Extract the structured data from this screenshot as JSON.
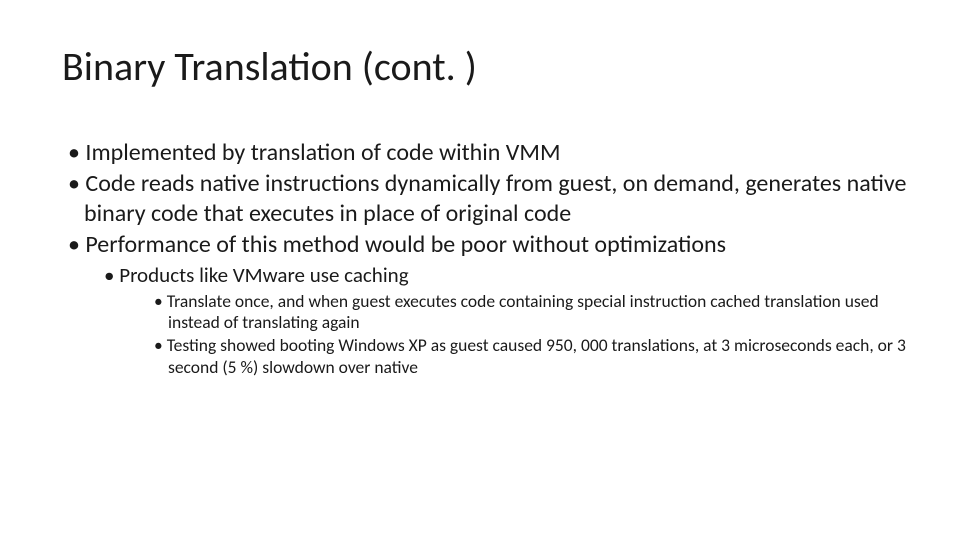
{
  "slide": {
    "title": "Binary Translation (cont. )",
    "bullets": {
      "b1": "Implemented by translation of code within VMM",
      "b2": "Code reads native instructions dynamically from guest, on demand, generates native binary code that executes in place of original code",
      "b3": "Performance of this method would be poor without optimizations",
      "b3_1": "Products like VMware use caching",
      "b3_1_1": "Translate once, and when guest executes code containing special instruction cached translation used instead of translating again",
      "b3_1_2": "Testing showed booting Windows XP as guest caused 950, 000 translations, at 3 microseconds each, or 3 second (5 %) slowdown over native"
    }
  }
}
